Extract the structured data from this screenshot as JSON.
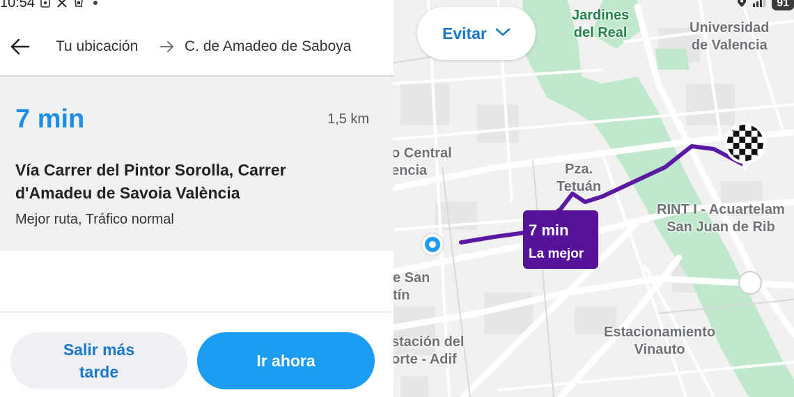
{
  "status_bar": {
    "time": "10:54",
    "icons": [
      "screenshot-icon",
      "x-icon",
      "app-icon",
      "dot-icon"
    ],
    "right_icons": [
      "location-icon",
      "signal-icon",
      "battery-icon"
    ],
    "battery": "91"
  },
  "route_header": {
    "origin": "Tu ubicación",
    "destination": "C. de Amadeo de Saboya"
  },
  "route_card": {
    "duration": "7 min",
    "distance": "1,5 km",
    "via": "Vía Carrer del Pintor Sorolla, Carrer d'Amadeu de Savoia València",
    "note": "Mejor ruta, Tráfico normal"
  },
  "actions": {
    "later_label": "Salir más tarde",
    "go_label": "Ir ahora"
  },
  "map": {
    "avoid_label": "Evitar",
    "route_time": "7 min",
    "route_tag": "La mejor",
    "labels": {
      "jardines": "Jardines\ndel Real",
      "universidad": "Universidad\nde Valencia",
      "central": "o Central\nencia",
      "pza": "Pza.\nTetuán",
      "rint": "RINT I - Acuartelam\nSan Juan de Rib",
      "san": "e San\ntín",
      "estacion_norte": "stación del\norte - Adif",
      "estacionamiento": "Estacionamiento\nVinauto"
    },
    "colors": {
      "route": "#5a1aa6",
      "park": "#bfe8cc",
      "accent": "#1c8ee6"
    }
  }
}
